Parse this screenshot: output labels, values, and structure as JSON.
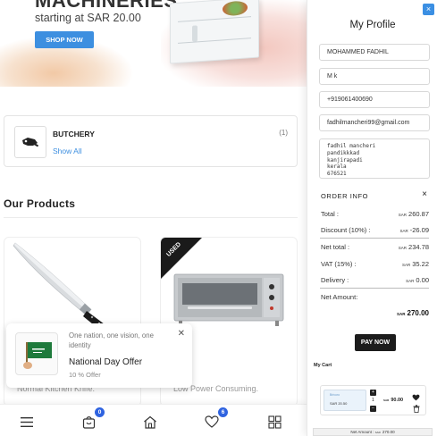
{
  "banner": {
    "title": "MACHINERIES",
    "subtitle": "starting at SAR 20.00",
    "shop_button": "SHOP NOW"
  },
  "category": {
    "name": "BUTCHERY",
    "link": "Show All",
    "count": "(1)"
  },
  "products": {
    "section_title": "Our Products",
    "items": [
      {
        "description": "Normal Kitchen Knife.",
        "badge": ""
      },
      {
        "description": "Low Power Consuming.",
        "badge": "USED"
      }
    ]
  },
  "offer_popup": {
    "tagline": "One nation, one vision, one identity",
    "title": "National Day Offer",
    "discount": "10 % Offer"
  },
  "bottom_nav": {
    "cart_badge": "0",
    "wishlist_badge": "6",
    "icons": [
      "menu-icon",
      "bag-icon",
      "home-icon",
      "heart-icon",
      "grid-icon"
    ]
  },
  "profile": {
    "title": "My Profile",
    "close": "×",
    "name": "MOHAMMED FADHIL",
    "last_name": "M k",
    "phone": "+919061400690",
    "email": "fadhilmancheri99@gmail.com",
    "address_lines": [
      "fadhil mancheri",
      "pandikkkad",
      "kanjirapadi",
      "kerala",
      "676521"
    ]
  },
  "order_info": {
    "title": "ORDER INFO",
    "close": "×",
    "currency": "SAR",
    "rows": {
      "total_label": "Total :",
      "total_value": "260.87",
      "discount_label": "Discount (10%) :",
      "discount_value": "-26.09",
      "net_total_label": "Net total :",
      "net_total_value": "234.78",
      "vat_label": "VAT (15%) :",
      "vat_value": "35.22",
      "delivery_label": "Delivery :",
      "delivery_value": "0.00",
      "net_amount_label": "Net Amount:"
    },
    "net_amount_value": "270.00",
    "pay_button": "PAY NOW"
  },
  "cart": {
    "title": "My Cart",
    "item": {
      "thumb_brand": "Brivoro",
      "thumb_price": "SAR 20.50",
      "quantity": "1",
      "price": "90.00"
    },
    "net_bar_label": "Net Amount :",
    "net_bar_value": "270.00"
  },
  "colors": {
    "accent": "#3d8fe0",
    "badge": "#2f63e0",
    "pay_button": "#1c1c1c"
  }
}
